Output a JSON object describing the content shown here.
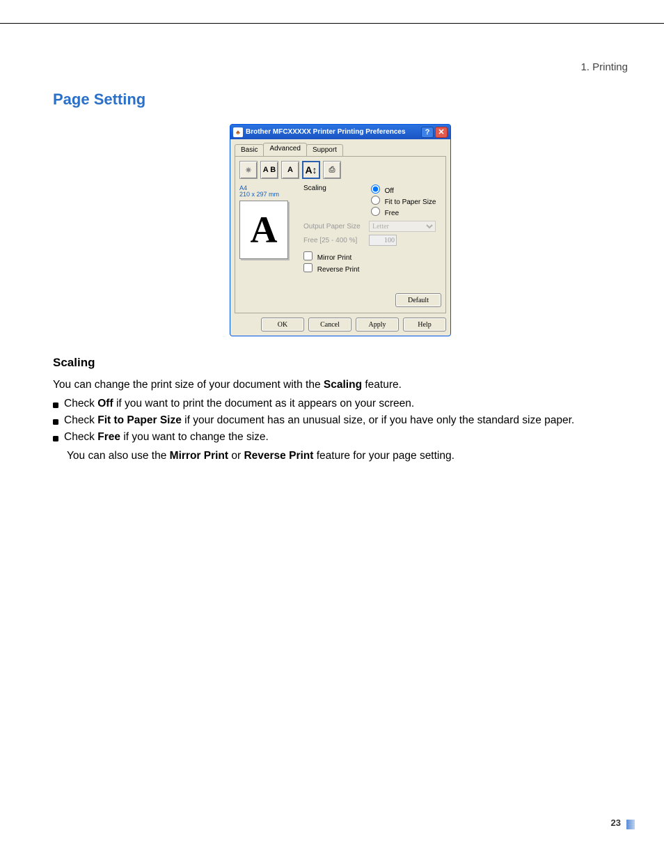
{
  "breadcrumb": "1. Printing",
  "heading": "Page Setting",
  "page_number": "23",
  "dialog": {
    "icon_glyph": "♣",
    "title": "Brother MFCXXXXX Printer Printing Preferences",
    "help_glyph": "?",
    "close_glyph": "✕",
    "tabs": [
      "Basic",
      "Advanced",
      "Support"
    ],
    "toolbar": [
      "✷",
      "A B",
      "A",
      "A↕",
      "⎙"
    ],
    "preview": {
      "paper_name": "A4",
      "paper_dims": "210 x 297 mm",
      "sample_glyph": "A"
    },
    "scaling": {
      "label": "Scaling",
      "options": [
        "Off",
        "Fit to Paper Size",
        "Free"
      ]
    },
    "output_paper": {
      "label": "Output Paper Size",
      "value": "Letter"
    },
    "free_pct": {
      "label": "Free [25 - 400 %]",
      "value": "100"
    },
    "checks": [
      "Mirror Print",
      "Reverse Print"
    ],
    "default_btn": "Default",
    "buttons": [
      "OK",
      "Cancel",
      "Apply",
      "Help"
    ]
  },
  "doc": {
    "scaling_heading": "Scaling",
    "intro": {
      "pre": "You can change the print size of your document with the ",
      "bold": "Scaling",
      "post": " feature."
    },
    "bullets": [
      {
        "pre": "Check ",
        "bold": "Off",
        "post": " if you want to print the document as it appears on your screen."
      },
      {
        "pre": "Check ",
        "bold": "Fit to Paper Size",
        "post": " if your document has an unusual size, or if you have only the standard size paper."
      },
      {
        "pre": "Check ",
        "bold": "Free",
        "post": " if you want to change the size."
      }
    ],
    "note": {
      "pre": "You can also use the ",
      "bold1": "Mirror Print",
      "mid": " or ",
      "bold2": "Reverse Print",
      "post": " feature for your page setting."
    }
  }
}
